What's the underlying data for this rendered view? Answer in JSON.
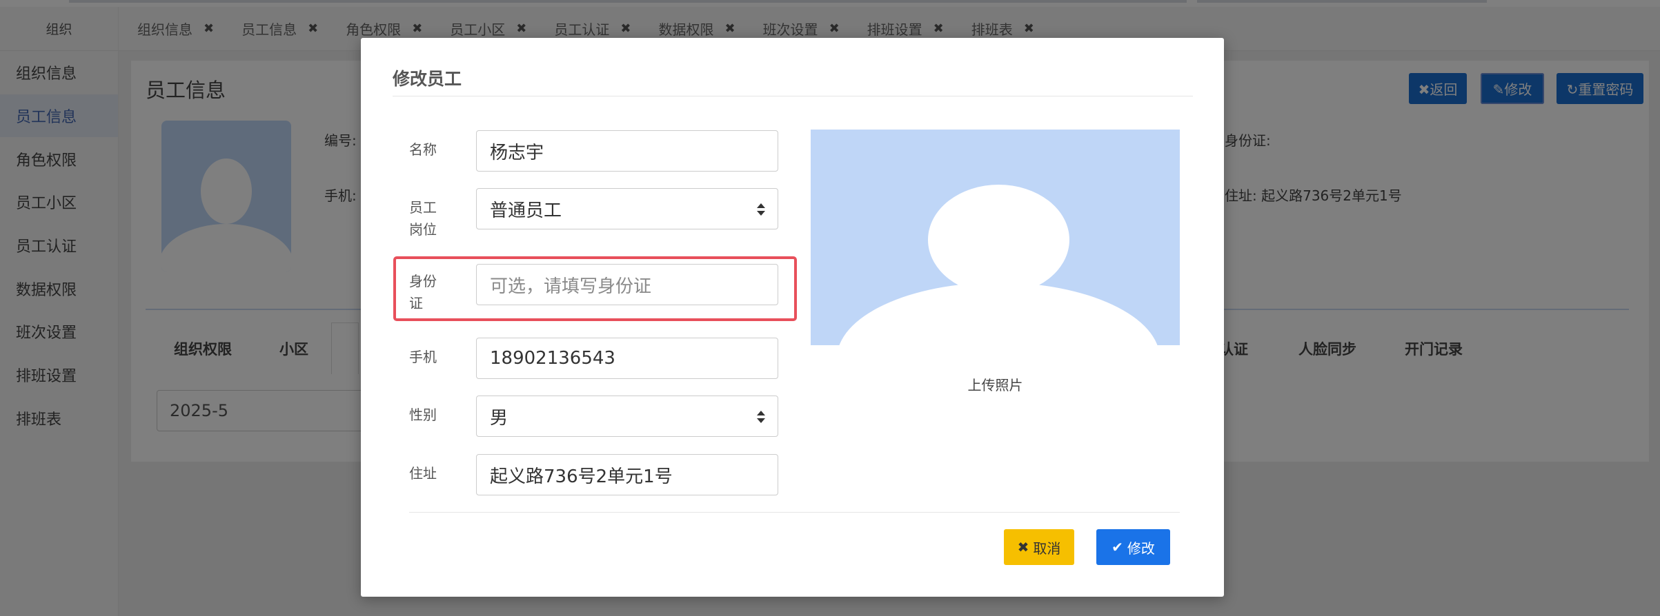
{
  "sidebar": {
    "header": "组织",
    "items": [
      {
        "label": "组织信息",
        "active": false
      },
      {
        "label": "员工信息",
        "active": true
      },
      {
        "label": "角色权限",
        "active": false
      },
      {
        "label": "员工小区",
        "active": false
      },
      {
        "label": "员工认证",
        "active": false
      },
      {
        "label": "数据权限",
        "active": false
      },
      {
        "label": "班次设置",
        "active": false
      },
      {
        "label": "排班设置",
        "active": false
      },
      {
        "label": "排班表",
        "active": false
      }
    ]
  },
  "tabs": [
    {
      "label": "组织信息"
    },
    {
      "label": "员工信息"
    },
    {
      "label": "角色权限"
    },
    {
      "label": "员工小区"
    },
    {
      "label": "员工认证"
    },
    {
      "label": "数据权限"
    },
    {
      "label": "班次设置"
    },
    {
      "label": "排班设置"
    },
    {
      "label": "排班表"
    }
  ],
  "tab_close_glyph": "✖",
  "background": {
    "page_title": "员工信息",
    "label_code": "编号:",
    "label_phone": "手机:",
    "label_idcard": "身份证:",
    "label_address": "住址:",
    "address_value": "起义路736号2单元1号",
    "btn_back": "✖返回",
    "btn_edit": "✎修改",
    "btn_reset": "↻重置密码",
    "subtabs": [
      "组织权限",
      "小区",
      "认证",
      "人脸同步",
      "开门记录"
    ],
    "month_value": "2025-5"
  },
  "modal": {
    "title": "修改员工",
    "fields": {
      "name": {
        "label": "名称",
        "value": "杨志宇"
      },
      "position": {
        "label_line1": "员工",
        "label_line2": "岗位",
        "value": "普通员工"
      },
      "idcard": {
        "label_line1": "身份",
        "label_line2": "证",
        "placeholder": "可选，请填写身份证"
      },
      "phone": {
        "label": "手机",
        "value": "18902136543"
      },
      "gender": {
        "label": "性别",
        "value": "男"
      },
      "address": {
        "label": "住址",
        "value": "起义路736号2单元1号"
      }
    },
    "upload_label": "上传照片",
    "cancel_icon": "✖",
    "cancel_label": "取消",
    "ok_icon": "✔",
    "ok_label": "修改"
  },
  "colors": {
    "primary": "#1a73e8",
    "warning": "#f6bf00",
    "highlight": "#e8505b",
    "photo_bg": "#bfd6f7",
    "active_menu": "#4266b3"
  }
}
